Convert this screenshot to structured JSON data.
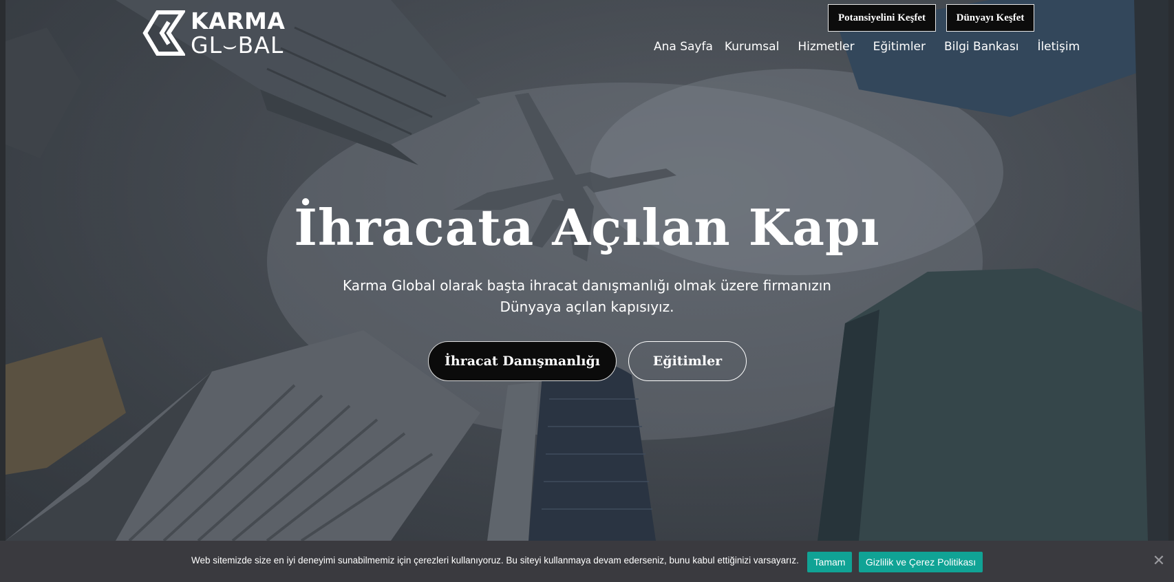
{
  "brand": {
    "line1": "KARMA",
    "line2": "GL⌣BAL",
    "logo_icon": "karma-k-mark-icon"
  },
  "header_buttons": {
    "potansiyel": "Potansiyelini Keşfet",
    "dunya": "Dünyayı Keşfet"
  },
  "nav": [
    {
      "label": "Ana Sayfa"
    },
    {
      "label": "Kurumsal"
    },
    {
      "label": "Hizmetler"
    },
    {
      "label": "Eğitimler"
    },
    {
      "label": "Bilgi Bankası"
    },
    {
      "label": "İletişim"
    }
  ],
  "hero": {
    "title": "İhracata Açılan Kapı",
    "subtitle_line1": "Karma Global olarak başta ihracat danışmanlığı olmak üzere firmanızın",
    "subtitle_line2": "Dünyaya açılan kapısıyız.",
    "cta_primary": "İhracat Danışmanlığı",
    "cta_secondary": "Eğitimler"
  },
  "cookie": {
    "text": "Web sitemizde size en iyi deneyimi sunabilmemiz için çerezleri kullanıyoruz. Bu siteyi kullanmaya devam ederseniz, bunu kabul ettiğinizi varsayarız.",
    "accept": "Tamam",
    "policy": "Gizlilik ve Çerez Politikası",
    "close_icon": "close-icon"
  },
  "colors": {
    "accent_teal": "#10a395",
    "cookie_bg": "#3a3a3f",
    "button_dark": "#0b0b0b"
  }
}
